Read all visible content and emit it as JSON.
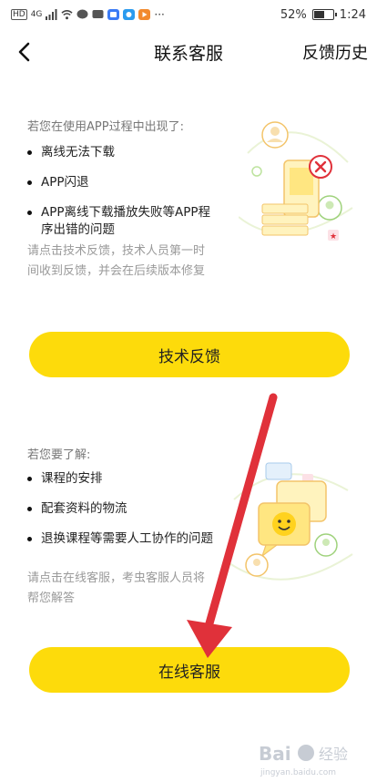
{
  "status": {
    "battery": "52%",
    "time": "1:24",
    "network": "4G"
  },
  "nav": {
    "title": "联系客服",
    "history": "反馈历史"
  },
  "tech": {
    "intro": "若您在使用APP过程中出现了:",
    "items": [
      "离线无法下载",
      "APP闪退",
      "APP离线下载播放失败等APP程序出错的问题"
    ],
    "note": "请点击技术反馈，技术人员第一时间收到反馈，并会在后续版本修复",
    "button": "技术反馈"
  },
  "online": {
    "intro": "若您要了解:",
    "items": [
      "课程的安排",
      "配套资料的物流",
      "退换课程等需要人工协作的问题"
    ],
    "note": "请点击在线客服，考虫客服人员将帮您解答",
    "button": "在线客服"
  },
  "watermark": {
    "text": "Bai 经验",
    "url": "jingyan.baidu.com"
  },
  "colors": {
    "accent": "#FDDB0B",
    "arrow": "#E0313A"
  }
}
